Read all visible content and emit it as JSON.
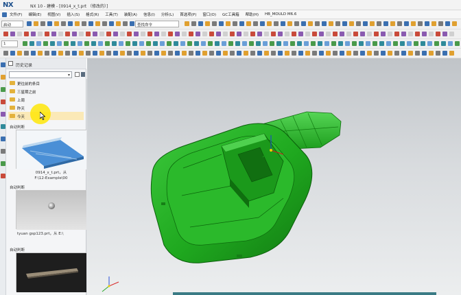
{
  "window": {
    "logo": "NX",
    "title": "NX 10 - 建模 - [0914_x_t.prt （修改的）]"
  },
  "menubar": {
    "items": [
      "文件(F)",
      "编辑(E)",
      "视图(V)",
      "插入(S)",
      "格式(R)",
      "工具(T)",
      "装配(A)",
      "信息(I)",
      "分析(L)",
      "首选项(P)",
      "窗口(O)",
      "GC工具箱",
      "帮助(H)",
      "HB_MOULD M6.6"
    ]
  },
  "toolbar1": {
    "start_label": "启动",
    "command_search_value": "查找命令"
  },
  "toolbar2": {
    "filter_value": "1"
  },
  "history_panel": {
    "title": "历史记录",
    "folders": [
      "更往前的条目",
      "三星期之前",
      "上周",
      "昨天",
      "今天"
    ],
    "entries": [
      {
        "label": "自动判断",
        "caption_line1": "0914_x_t.prt，从",
        "caption_line2": "F:\\12-Example\\00"
      },
      {
        "label": "自动判断",
        "caption_line1": "tyuan gsp123.prt，从 E:\\",
        "caption_line2": ""
      },
      {
        "label": "自动判断",
        "caption_line1": "",
        "caption_line2": ""
      }
    ]
  },
  "colors": {
    "model_green": "#1fa81f",
    "highlight_yellow": "#ffe600",
    "folder_yellow": "#e3b23c"
  }
}
